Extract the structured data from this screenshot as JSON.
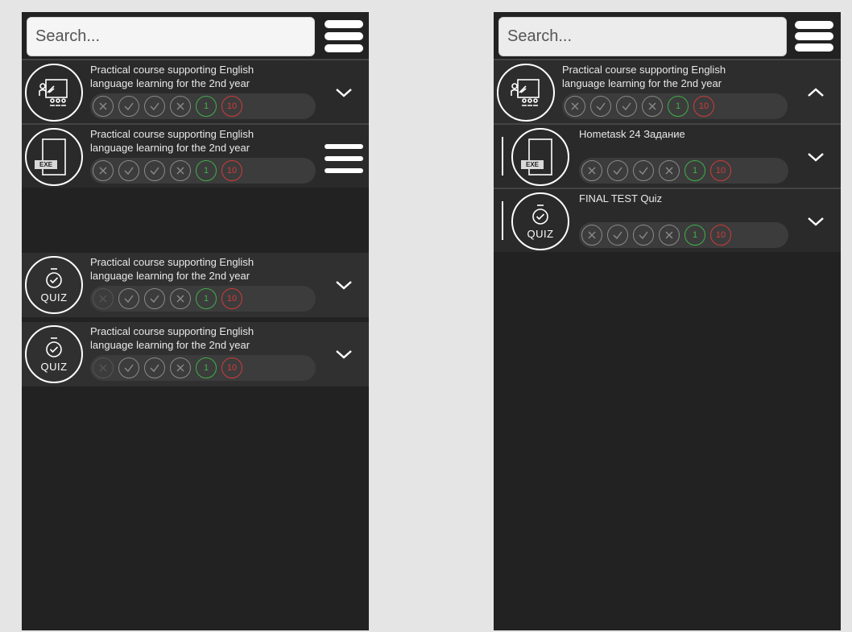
{
  "left_panel": {
    "search_placeholder": "Search...",
    "items": [
      {
        "title": "Practical course supporting English language learning for the 2nd year",
        "count_green": "1",
        "count_red": "10"
      },
      {
        "title": "Practical course supporting English language learning for the 2nd year",
        "count_green": "1",
        "count_red": "10",
        "tag": "EXE"
      },
      {
        "title": "Practical course supporting English language learning for the 2nd year",
        "count_green": "1",
        "count_red": "10",
        "icon_label": "QUIZ"
      },
      {
        "title": "Practical course supporting English language learning for the 2nd year",
        "count_green": "1",
        "count_red": "10",
        "icon_label": "QUIZ"
      }
    ]
  },
  "right_panel": {
    "search_placeholder": "Search...",
    "items": [
      {
        "title": "Practical course supporting English language learning for the 2nd year",
        "count_green": "1",
        "count_red": "10"
      },
      {
        "title": "Hometask 24 Задание",
        "count_green": "1",
        "count_red": "10",
        "tag": "EXE"
      },
      {
        "title": "FINAL TEST Quiz",
        "count_green": "1",
        "count_red": "10",
        "icon_label": "QUIZ"
      }
    ]
  },
  "colors": {
    "panel_bg": "#222222",
    "row_bg": "#2a2a2a",
    "green": "#3fb04a",
    "red": "#d03b3b",
    "page_bg": "#e5e5e5"
  },
  "icons": [
    "menu-icon",
    "presentation-icon",
    "exe-file-icon",
    "stopwatch-icon",
    "x-circle-icon",
    "check-circle-icon",
    "chevron-down-icon",
    "chevron-up-icon"
  ]
}
